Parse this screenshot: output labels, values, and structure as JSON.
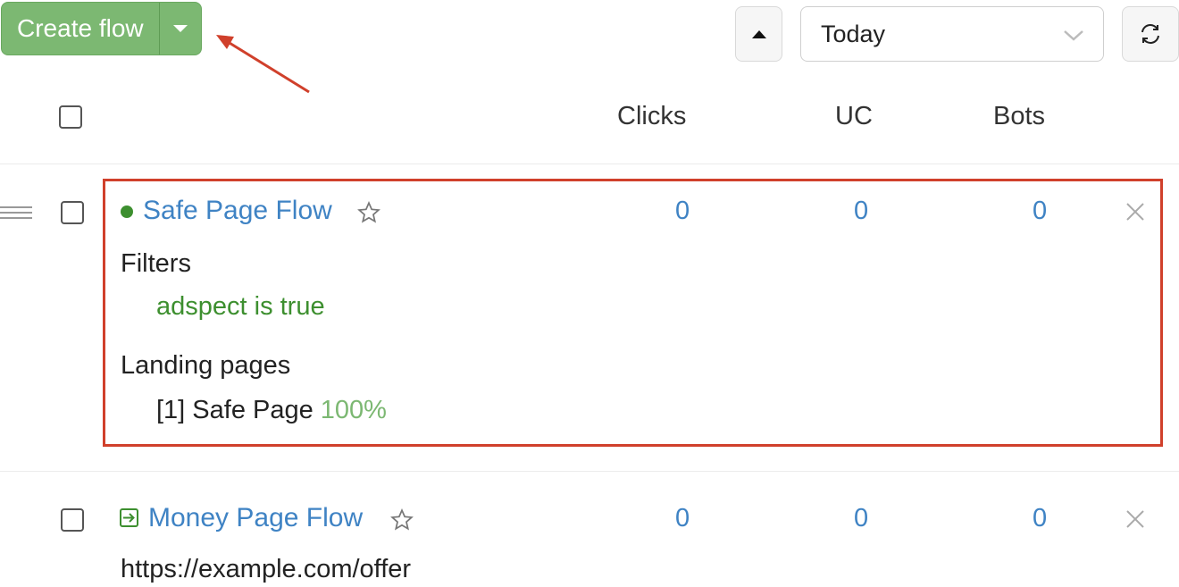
{
  "toolbar": {
    "create_label": "Create flow",
    "period": "Today"
  },
  "table": {
    "columns": [
      "Clicks",
      "UC",
      "Bots"
    ]
  },
  "flows": [
    {
      "name": "Safe Page Flow",
      "clicks": "0",
      "uc": "0",
      "bots": "0",
      "filters_label": "Filters",
      "filter": "adspect is true",
      "landing_label": "Landing pages",
      "landing_page": "[1] Safe Page",
      "landing_share": "100%",
      "status_color": "#3d8f2f"
    },
    {
      "name": "Money Page Flow",
      "clicks": "0",
      "uc": "0",
      "bots": "0",
      "url": "https://example.com/offer",
      "icon": "redirect-icon"
    }
  ],
  "colors": {
    "accent_green": "#7cb872",
    "link_blue": "#3f83c4",
    "annotation_red": "#d0402b"
  }
}
